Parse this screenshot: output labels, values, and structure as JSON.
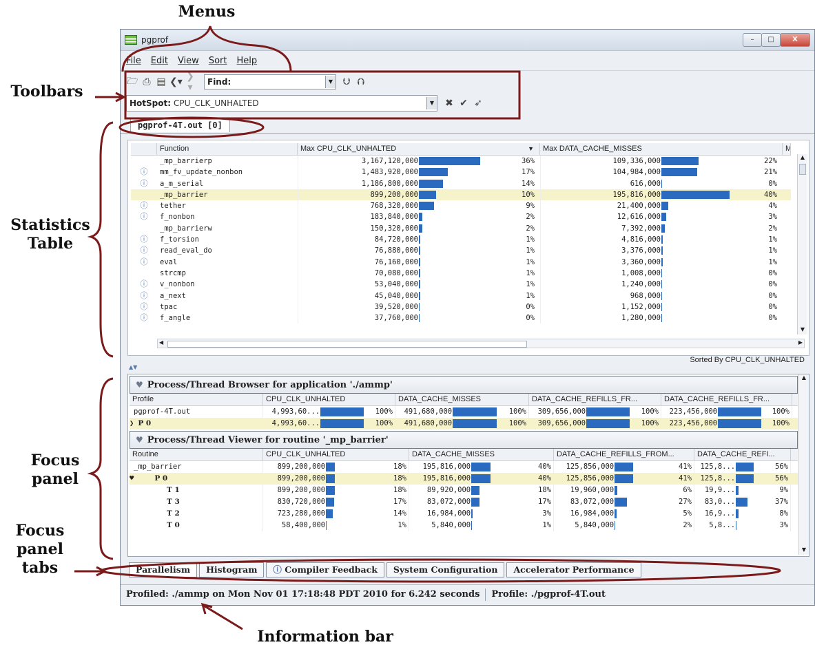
{
  "annotations": {
    "menus": "Menus",
    "toolbars": "Toolbars",
    "statistics_table": "Statistics\nTable",
    "focus_panel": "Focus\npanel",
    "focus_panel_tabs": "Focus\npanel\ntabs",
    "information_bar": "Information bar"
  },
  "window": {
    "title": "pgprof",
    "buttons": [
      "–",
      "□",
      "X"
    ]
  },
  "menus": [
    "File",
    "Edit",
    "View",
    "Sort",
    "Help"
  ],
  "toolbar": {
    "find_label": "Find:",
    "hotspot_label": "HotSpot:",
    "hotspot_value": "CPU_CLK_UNHALTED"
  },
  "file_tab": "pgprof-4T.out [0]",
  "stats_table": {
    "headers": [
      "Function",
      "Max CPU_CLK_UNHALTED",
      "Max DATA_CACHE_MISSES",
      "M"
    ],
    "rows": [
      {
        "info": false,
        "fn": "_mp_barrierp",
        "v1": "3,167,120,000",
        "b1": 36,
        "p1": "36%",
        "v2": "109,336,000",
        "b2": 22,
        "p2": "22%"
      },
      {
        "info": true,
        "fn": "mm_fv_update_nonbon",
        "v1": "1,483,920,000",
        "b1": 17,
        "p1": "17%",
        "v2": "104,984,000",
        "b2": 21,
        "p2": "21%"
      },
      {
        "info": true,
        "fn": "a_m_serial",
        "v1": "1,186,800,000",
        "b1": 14,
        "p1": "14%",
        "v2": "616,000",
        "b2": 0,
        "p2": "0%"
      },
      {
        "info": false,
        "fn": "_mp_barrier",
        "v1": "899,200,000",
        "b1": 10,
        "p1": "10%",
        "v2": "195,816,000",
        "b2": 40,
        "p2": "40%",
        "hl": true
      },
      {
        "info": true,
        "fn": "tether",
        "v1": "768,320,000",
        "b1": 9,
        "p1": "9%",
        "v2": "21,400,000",
        "b2": 4,
        "p2": "4%"
      },
      {
        "info": true,
        "fn": "f_nonbon",
        "v1": "183,840,000",
        "b1": 2,
        "p1": "2%",
        "v2": "12,616,000",
        "b2": 3,
        "p2": "3%"
      },
      {
        "info": false,
        "fn": "_mp_barrierw",
        "v1": "150,320,000",
        "b1": 2,
        "p1": "2%",
        "v2": "7,392,000",
        "b2": 2,
        "p2": "2%"
      },
      {
        "info": true,
        "fn": "f_torsion",
        "v1": "84,720,000",
        "b1": 1,
        "p1": "1%",
        "v2": "4,816,000",
        "b2": 1,
        "p2": "1%"
      },
      {
        "info": true,
        "fn": "read_eval_do",
        "v1": "76,880,000",
        "b1": 1,
        "p1": "1%",
        "v2": "3,376,000",
        "b2": 1,
        "p2": "1%"
      },
      {
        "info": true,
        "fn": "eval",
        "v1": "76,160,000",
        "b1": 1,
        "p1": "1%",
        "v2": "3,360,000",
        "b2": 1,
        "p2": "1%"
      },
      {
        "info": false,
        "fn": "strcmp",
        "v1": "70,080,000",
        "b1": 1,
        "p1": "1%",
        "v2": "1,008,000",
        "b2": 0,
        "p2": "0%"
      },
      {
        "info": true,
        "fn": "v_nonbon",
        "v1": "53,040,000",
        "b1": 1,
        "p1": "1%",
        "v2": "1,240,000",
        "b2": 0,
        "p2": "0%"
      },
      {
        "info": true,
        "fn": "a_next",
        "v1": "45,040,000",
        "b1": 1,
        "p1": "1%",
        "v2": "968,000",
        "b2": 0,
        "p2": "0%"
      },
      {
        "info": true,
        "fn": "tpac",
        "v1": "39,520,000",
        "b1": 0,
        "p1": "0%",
        "v2": "1,152,000",
        "b2": 0,
        "p2": "0%"
      },
      {
        "info": true,
        "fn": "f_angle",
        "v1": "37,760,000",
        "b1": 0,
        "p1": "0%",
        "v2": "1,280,000",
        "b2": 0,
        "p2": "0%"
      }
    ],
    "sorted_by": "Sorted By CPU_CLK_UNHALTED"
  },
  "browser": {
    "title": "Process/Thread Browser for application './ammp'",
    "headers": [
      "Profile",
      "CPU_CLK_UNHALTED",
      "DATA_CACHE_MISSES",
      "DATA_CACHE_REFILLS_FR...",
      "DATA_CACHE_REFILLS_FR..."
    ],
    "rows": [
      {
        "name": "pgprof-4T.out",
        "cells": [
          [
            "4,993,60...",
            100,
            "100%"
          ],
          [
            "491,680,000",
            100,
            "100%"
          ],
          [
            "309,656,000",
            100,
            "100%"
          ],
          [
            "223,456,000",
            100,
            "100%"
          ]
        ]
      },
      {
        "name": "P 0",
        "hl": true,
        "cells": [
          [
            "4,993,60...",
            100,
            "100%"
          ],
          [
            "491,680,000",
            100,
            "100%"
          ],
          [
            "309,656,000",
            100,
            "100%"
          ],
          [
            "223,456,000",
            100,
            "100%"
          ]
        ]
      }
    ]
  },
  "viewer": {
    "title": "Process/Thread Viewer for routine '_mp_barrier'",
    "headers": [
      "Routine",
      "CPU_CLK_UNHALTED",
      "DATA_CACHE_MISSES",
      "DATA_CACHE_REFILLS_FROM...",
      "DATA_CACHE_REFI..."
    ],
    "rows": [
      {
        "name": "_mp_barrier",
        "indent": 0,
        "cells": [
          [
            "899,200,000",
            18,
            "18%"
          ],
          [
            "195,816,000",
            40,
            "40%"
          ],
          [
            "125,856,000",
            41,
            "41%"
          ],
          [
            "125,8...",
            56,
            "56%"
          ]
        ]
      },
      {
        "name": "P 0",
        "indent": 1,
        "hl": true,
        "cells": [
          [
            "899,200,000",
            18,
            "18%"
          ],
          [
            "195,816,000",
            40,
            "40%"
          ],
          [
            "125,856,000",
            41,
            "41%"
          ],
          [
            "125,8...",
            56,
            "56%"
          ]
        ]
      },
      {
        "name": "T 1",
        "indent": 2,
        "cells": [
          [
            "899,200,000",
            18,
            "18%"
          ],
          [
            "89,920,000",
            18,
            "18%"
          ],
          [
            "19,960,000",
            6,
            "6%"
          ],
          [
            "19,9...",
            9,
            "9%"
          ]
        ]
      },
      {
        "name": "T 3",
        "indent": 2,
        "cells": [
          [
            "830,720,000",
            17,
            "17%"
          ],
          [
            "83,072,000",
            17,
            "17%"
          ],
          [
            "83,072,000",
            27,
            "27%"
          ],
          [
            "83,0...",
            37,
            "37%"
          ]
        ]
      },
      {
        "name": "T 2",
        "indent": 2,
        "cells": [
          [
            "723,280,000",
            14,
            "14%"
          ],
          [
            "16,984,000",
            3,
            "3%"
          ],
          [
            "16,984,000",
            5,
            "5%"
          ],
          [
            "16,9...",
            8,
            "8%"
          ]
        ]
      },
      {
        "name": "T 0",
        "indent": 2,
        "cells": [
          [
            "58,400,000",
            1,
            "1%"
          ],
          [
            "5,840,000",
            1,
            "1%"
          ],
          [
            "5,840,000",
            2,
            "2%"
          ],
          [
            "5,8...",
            3,
            "3%"
          ]
        ]
      }
    ]
  },
  "focus_tabs": [
    "Parallelism",
    "Histogram",
    "Compiler Feedback",
    "System Configuration",
    "Accelerator Performance"
  ],
  "info_bar": {
    "profiled": "Profiled: ./ammp on Mon Nov 01 17:18:48 PDT 2010 for 6.242 seconds",
    "profile": "Profile: ./pgprof-4T.out"
  },
  "colors": {
    "bar": "#2b6bbf",
    "highlight_row": "#f6f2c9",
    "annotation": "#7a1a1a"
  }
}
